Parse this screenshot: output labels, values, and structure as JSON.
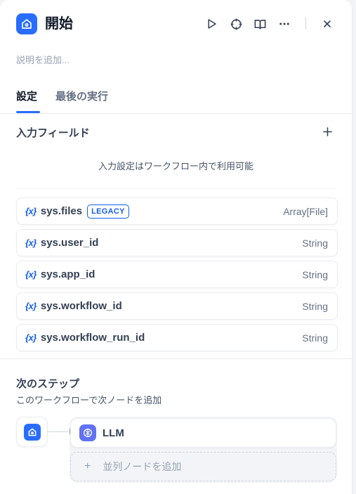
{
  "header": {
    "title": "開始",
    "description_placeholder": "説明を追加..."
  },
  "tabs": [
    {
      "label": "設定",
      "active": true
    },
    {
      "label": "最後の実行",
      "active": false
    }
  ],
  "input_fields": {
    "title": "入力フィールド",
    "hint": "入力設定はワークフロー内で利用可能",
    "variables": [
      {
        "icon": "{x}",
        "name": "sys.files",
        "badge": "LEGACY",
        "type": "Array[File]"
      },
      {
        "icon": "{x}",
        "name": "sys.user_id",
        "type": "String"
      },
      {
        "icon": "{x}",
        "name": "sys.app_id",
        "type": "String"
      },
      {
        "icon": "{x}",
        "name": "sys.workflow_id",
        "type": "String"
      },
      {
        "icon": "{x}",
        "name": "sys.workflow_run_id",
        "type": "String"
      }
    ]
  },
  "next_step": {
    "title": "次のステップ",
    "subtitle": "このワークフローで次ノードを追加",
    "nodes": [
      {
        "label": "LLM"
      }
    ],
    "add_parallel": "並列ノードを追加"
  },
  "colors": {
    "accent": "#296dff",
    "llm": "#6172f3",
    "badge": "#155eef"
  }
}
